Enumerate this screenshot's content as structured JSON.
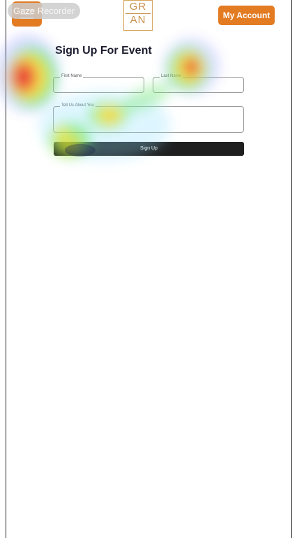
{
  "overlay": {
    "label": "Gaze Recorder"
  },
  "header": {
    "logo_top": "GR",
    "logo_bottom": "AN",
    "account_label": "My Account"
  },
  "form": {
    "title": "Sign Up For Event",
    "first_name_label": "First Name",
    "last_name_label": "Last Name",
    "about_label": "Tell Us About You",
    "submit_label": "Sign Up"
  },
  "colors": {
    "accent": "#e37b22",
    "button_dark": "#1f1f1f",
    "logo_gold": "#c89350"
  }
}
